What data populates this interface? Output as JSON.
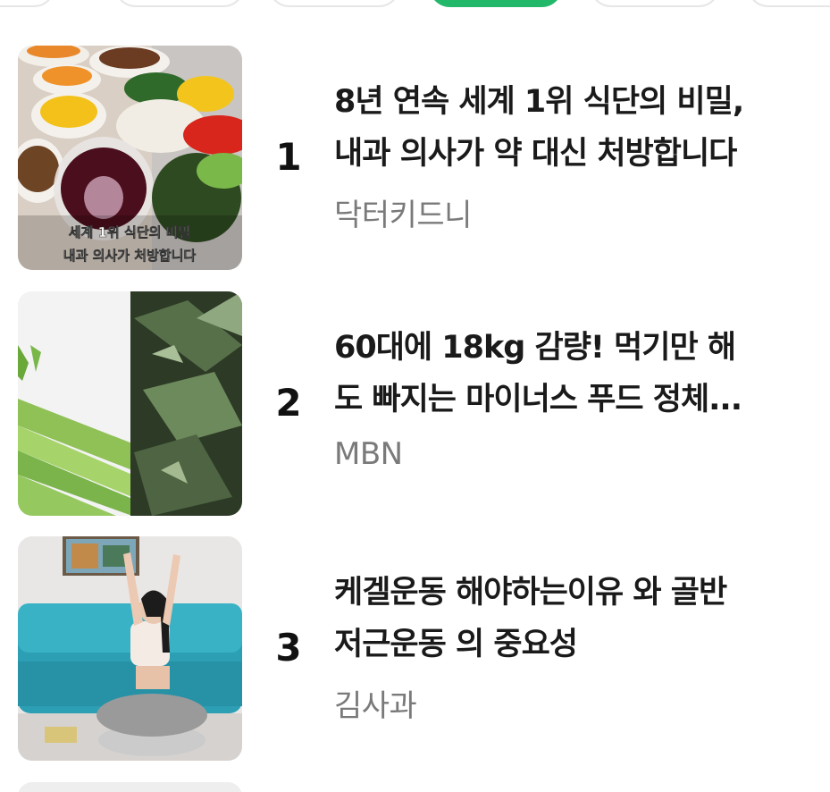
{
  "chips": [
    {
      "name": "chip-1",
      "active": false
    },
    {
      "name": "chip-2",
      "active": false
    },
    {
      "name": "chip-3",
      "active": false
    },
    {
      "name": "chip-4",
      "active": true
    },
    {
      "name": "chip-5",
      "active": false
    },
    {
      "name": "chip-6",
      "active": false
    }
  ],
  "items": [
    {
      "rank": "1",
      "title_line1": "8년 연속 세계 1위 식단의 비밀,",
      "title_line2": "내과 의사가 약 대신 처방합니다",
      "author": "닥터키드니",
      "thumb_caption_line1": "세계 1위 식단의 비밀",
      "thumb_caption_line2": "내과 의사가 처방합니다"
    },
    {
      "rank": "2",
      "title_line1": "60대에 18kg 감량! 먹기만 해",
      "title_line2": "도 빠지는 마이너스 푸드 정체...",
      "author": "MBN"
    },
    {
      "rank": "3",
      "title_line1": "케겔운동 해야하는이유 와 골반",
      "title_line2": "저근운동 의 중요성",
      "author": "김사과"
    }
  ],
  "colors": {
    "accent": "#22b86a",
    "title": "#1a1a1a",
    "author": "#7a7a7a"
  }
}
